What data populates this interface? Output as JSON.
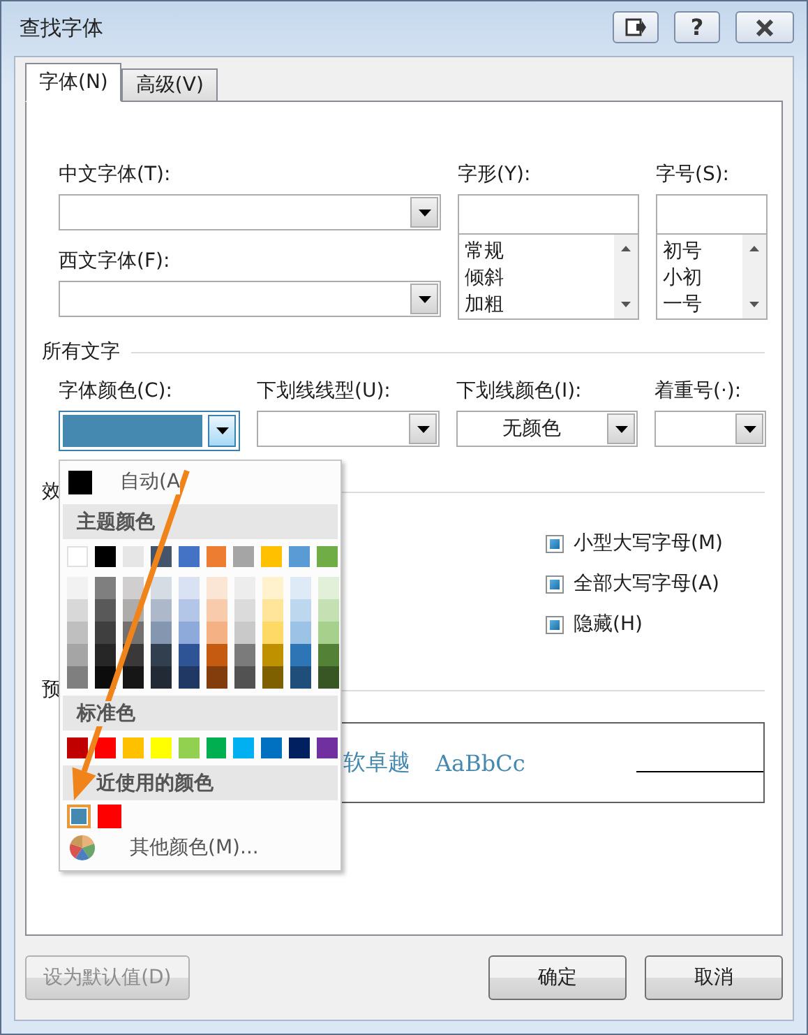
{
  "window": {
    "title": "查找字体",
    "help_label": "?"
  },
  "tabs": [
    {
      "label": "字体(N)",
      "selected": true
    },
    {
      "label": "高级(V)",
      "selected": false
    }
  ],
  "font": {
    "chinese_font": {
      "label": "中文字体(T):"
    },
    "western_font": {
      "label": "西文字体(F):"
    },
    "style": {
      "label": "字形(Y):",
      "options": [
        "常规",
        "倾斜",
        "加粗"
      ]
    },
    "size": {
      "label": "字号(S):",
      "options": [
        "初号",
        "小初",
        "一号"
      ]
    }
  },
  "all_text": {
    "title": "所有文字",
    "font_color": {
      "label": "字体颜色(C):",
      "color": "#4588b0"
    },
    "underline_style": {
      "label": "下划线线型(U):"
    },
    "underline_color": {
      "label": "下划线颜色(I):",
      "value": "无颜色"
    },
    "emphasis": {
      "label": "着重号(·):"
    }
  },
  "effects": {
    "title": "效",
    "options": [
      {
        "label": "小型大写字母(M)",
        "indeterminate": true
      },
      {
        "label": "全部大写字母(A)",
        "indeterminate": true
      },
      {
        "label": "隐藏(H)",
        "indeterminate": true
      }
    ]
  },
  "preview": {
    "title": "预",
    "texts": [
      "软卓越",
      "AaBbCc"
    ]
  },
  "color_menu": {
    "automatic": {
      "label": "自动(A",
      "color": "#000000"
    },
    "theme_title": "主题颜色",
    "theme_top": [
      {
        "color": "#ffffff"
      },
      {
        "color": "#000000"
      },
      {
        "color": "#e7e6e6"
      },
      {
        "color": "#44546a"
      },
      {
        "color": "#4472c4"
      },
      {
        "color": "#ed7d31"
      },
      {
        "color": "#a5a5a5"
      },
      {
        "color": "#ffc000"
      },
      {
        "color": "#5b9bd5"
      },
      {
        "color": "#70ad47"
      }
    ],
    "shade_rows": [
      [
        {
          "color": "#f2f2f2"
        },
        {
          "color": "#7f7f7f"
        },
        {
          "color": "#d0cece"
        },
        {
          "color": "#d6dce4"
        },
        {
          "color": "#d9e2f3"
        },
        {
          "color": "#fbe5d5"
        },
        {
          "color": "#ededed"
        },
        {
          "color": "#fff2cc"
        },
        {
          "color": "#deebf6"
        },
        {
          "color": "#e2efd9"
        }
      ],
      [
        {
          "color": "#d8d8d8"
        },
        {
          "color": "#595959"
        },
        {
          "color": "#aeabab"
        },
        {
          "color": "#adb9ca"
        },
        {
          "color": "#b4c6e7"
        },
        {
          "color": "#f7cbac"
        },
        {
          "color": "#dbdbdb"
        },
        {
          "color": "#fee599"
        },
        {
          "color": "#bdd7ee"
        },
        {
          "color": "#c5e0b3"
        }
      ],
      [
        {
          "color": "#bfbfbf"
        },
        {
          "color": "#3f3f3f"
        },
        {
          "color": "#757070"
        },
        {
          "color": "#8496b0"
        },
        {
          "color": "#8eaadb"
        },
        {
          "color": "#f4b183"
        },
        {
          "color": "#c9c9c9"
        },
        {
          "color": "#ffd965"
        },
        {
          "color": "#9cc3e5"
        },
        {
          "color": "#a8d08d"
        }
      ],
      [
        {
          "color": "#a5a5a5"
        },
        {
          "color": "#262626"
        },
        {
          "color": "#3a3838"
        },
        {
          "color": "#323f4f"
        },
        {
          "color": "#2f5496"
        },
        {
          "color": "#c55a11"
        },
        {
          "color": "#7b7b7b"
        },
        {
          "color": "#bf9000"
        },
        {
          "color": "#2e75b5"
        },
        {
          "color": "#538135"
        }
      ],
      [
        {
          "color": "#7f7f7f"
        },
        {
          "color": "#0c0c0c"
        },
        {
          "color": "#171616"
        },
        {
          "color": "#222a35"
        },
        {
          "color": "#1f3864"
        },
        {
          "color": "#833c0b"
        },
        {
          "color": "#525252"
        },
        {
          "color": "#7f6000"
        },
        {
          "color": "#1e4e79"
        },
        {
          "color": "#375623"
        }
      ]
    ],
    "standard_title": "标准色",
    "standard": [
      {
        "color": "#c00000"
      },
      {
        "color": "#ff0000"
      },
      {
        "color": "#ffc000"
      },
      {
        "color": "#ffff00"
      },
      {
        "color": "#92d050"
      },
      {
        "color": "#00b050"
      },
      {
        "color": "#00b0f0"
      },
      {
        "color": "#0070c0"
      },
      {
        "color": "#002060"
      },
      {
        "color": "#7030a0"
      }
    ],
    "recent_title": "近使用的颜色",
    "recent": [
      {
        "color": "#4588b0",
        "selected": true
      },
      {
        "color": "#ff0000",
        "selected": false
      }
    ],
    "more_colors": "其他颜色(M)..."
  },
  "buttons": [
    {
      "label": "设为默认值(D)",
      "disabled": true
    },
    {
      "label": "确定",
      "disabled": false
    },
    {
      "label": "取消",
      "disabled": false
    }
  ]
}
